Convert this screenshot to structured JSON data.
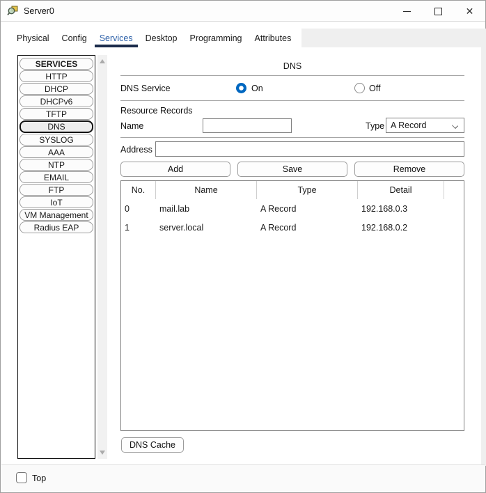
{
  "window": {
    "title": "Server0",
    "controls": {
      "minimize": "minimize",
      "maximize": "maximize",
      "close": "✕"
    }
  },
  "tabs": [
    {
      "label": "Physical",
      "active": false
    },
    {
      "label": "Config",
      "active": false
    },
    {
      "label": "Services",
      "active": true
    },
    {
      "label": "Desktop",
      "active": false
    },
    {
      "label": "Programming",
      "active": false
    },
    {
      "label": "Attributes",
      "active": false
    }
  ],
  "sidebar": {
    "header": "SERVICES",
    "items": [
      "HTTP",
      "DHCP",
      "DHCPv6",
      "TFTP",
      "DNS",
      "SYSLOG",
      "AAA",
      "NTP",
      "EMAIL",
      "FTP",
      "IoT",
      "VM Management",
      "Radius EAP"
    ],
    "selected": "DNS"
  },
  "panel": {
    "title": "DNS",
    "service_label": "DNS Service",
    "radio_on_label": "On",
    "radio_off_label": "Off",
    "service_state": "On",
    "resource_records_label": "Resource Records",
    "name_label": "Name",
    "name_value": "",
    "type_label": "Type",
    "type_value": "A Record",
    "address_label": "Address",
    "address_value": "",
    "buttons": {
      "add": "Add",
      "save": "Save",
      "remove": "Remove"
    },
    "table": {
      "headers": [
        "No.",
        "Name",
        "Type",
        "Detail"
      ],
      "rows": [
        {
          "no": "0",
          "name": "mail.lab",
          "type": "A Record",
          "detail": "192.168.0.3"
        },
        {
          "no": "1",
          "name": "server.local",
          "type": "A Record",
          "detail": "192.168.0.2"
        }
      ]
    },
    "dns_cache_button": "DNS Cache"
  },
  "footer": {
    "top_label": "Top",
    "top_checked": false
  },
  "colors": {
    "accent_blue": "#0067c0",
    "tab_active_text": "#2b5fa8",
    "tab_underline": "#1b2b4b",
    "icon_box_yellow": "#e5c44a"
  }
}
